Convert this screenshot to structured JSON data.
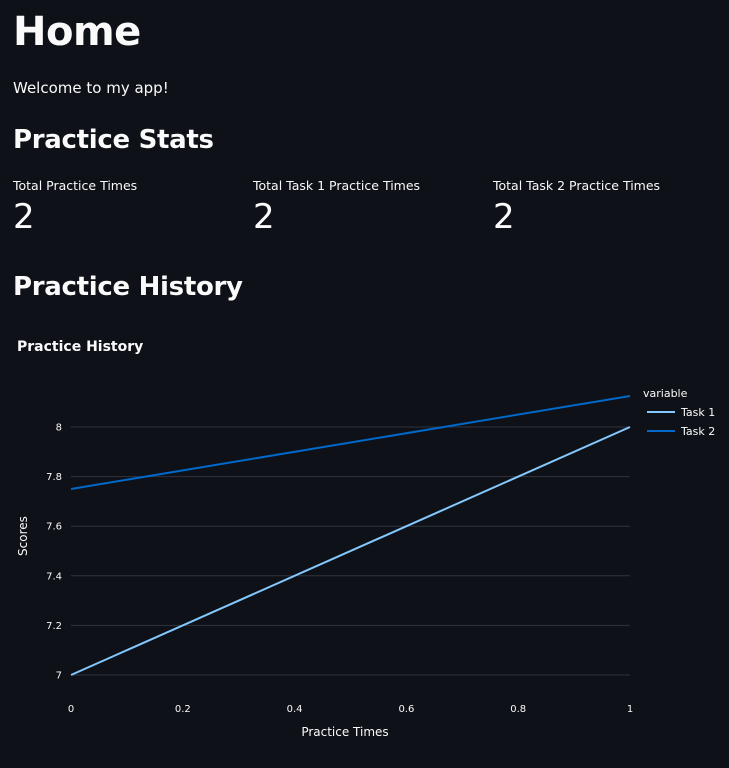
{
  "page": {
    "title": "Home",
    "welcome": "Welcome to my app!"
  },
  "stats": {
    "heading": "Practice Stats",
    "metrics": [
      {
        "label": "Total Practice Times",
        "value": "2"
      },
      {
        "label": "Total Task 1 Practice Times",
        "value": "2"
      },
      {
        "label": "Total Task 2 Practice Times",
        "value": "2"
      }
    ]
  },
  "history": {
    "heading": "Practice History"
  },
  "chart_data": {
    "type": "line",
    "title": "Practice History",
    "xlabel": "Practice Times",
    "ylabel": "Scores",
    "x": [
      0,
      1
    ],
    "xlim": [
      0,
      1
    ],
    "ylim": [
      7,
      8.2
    ],
    "x_ticks": [
      "0",
      "0.2",
      "0.4",
      "0.6",
      "0.8",
      "1"
    ],
    "y_ticks": [
      "7",
      "7.2",
      "7.4",
      "7.6",
      "7.8",
      "8"
    ],
    "grid": true,
    "legend_title": "variable",
    "legend_position": "top-right",
    "series": [
      {
        "name": "Task 1",
        "values": [
          7,
          8
        ],
        "color": "#83c9ff"
      },
      {
        "name": "Task 2",
        "values": [
          7.75,
          8.125
        ],
        "color": "#0068c9"
      }
    ]
  },
  "colors": {
    "background": "#0e1117",
    "text": "#fafafa",
    "grid": "#31333f"
  }
}
